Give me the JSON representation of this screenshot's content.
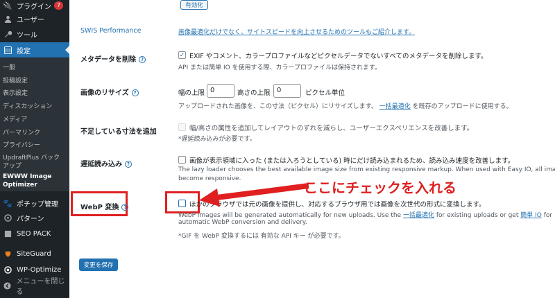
{
  "sidebar": {
    "plugins_label": "プラグイン",
    "plugins_badge": "7",
    "users_label": "ユーザー",
    "tools_label": "ツール",
    "settings_label": "設定",
    "submenu": [
      "一般",
      "投稿設定",
      "表示設定",
      "ディスカッション",
      "メディア",
      "パーマリンク",
      "プライバシー",
      "UpdraftPlus バック",
      "アップ",
      "EWWW Image",
      "Optimizer"
    ],
    "pochipp_label": "ポチップ管理",
    "patterns_label": "パターン",
    "seopack_label": "SEO PACK",
    "siteguard_label": "SiteGuard",
    "wpoptimize_label": "WP-Optimize",
    "close_menu_label": "メニューを閉じる"
  },
  "main": {
    "enable_button": "有効化",
    "swis_label": "SWIS Performance",
    "swis_link": "画像最適化だけでなく、サイトスピードを向上させるためのツールもご紹介します。",
    "metadata": {
      "label": "メタデータを削除",
      "option": "EXIF やコメント、カラープロファイルなどピクセルデータでないすべてのメタデータを削除します。",
      "desc": "API または簡単 IO を使用する際、カラープロファイルは保持されます。"
    },
    "resize": {
      "label": "画像のリサイズ",
      "width_label": "幅の上限",
      "width_value": "0",
      "height_label": "高さの上限",
      "height_value": "0",
      "unit_label": "ピクセル単位",
      "desc_prefix": "アップロードされた画像を、この寸法（ピクセル）にリサイズします。",
      "desc_link": "一括最適化",
      "desc_suffix": "を既存のアップロードに使用する。"
    },
    "dimensions": {
      "label": "不足している寸法を追加",
      "option": "幅/高さの属性を追加してレイアウトのずれを減らし、ユーザーエクスペリエンスを改善します。",
      "desc": "*遅延読み込みが必要です。"
    },
    "lazy": {
      "label": "遅延読み込み",
      "option": "画像が表示領域に入った (または入ろうとしている) 時にだけ読み込まれるため、読み込み速度を改善します。",
      "desc_line1": "The lazy loader chooses the best available image size from existing responsive markup. When used with Easy IO, all images",
      "desc_line2": "become responsive."
    },
    "webp": {
      "label": "WebP 変換",
      "option": "ほかのブラウザでは元の画像を提供し、対応するブラウザ用では画像を次世代の形式に変換します。",
      "desc_line1_prefix": "WebP images will be generated automatically for new uploads. Use the",
      "desc_line1_link1": "一括最適化",
      "desc_line1_mid": "for existing uploads or get",
      "desc_line1_link2": "簡単 IO",
      "desc_line1_suffix": "for",
      "desc_line2": "automatic WebP conversion and delivery.",
      "note": "*GIF を WebP 変換するには 有効な API キー が必要です。"
    },
    "save_button": "変更を保存",
    "annotation": "ここにチェックを入れる"
  },
  "colors": {
    "sidebar_bg": "#1d2327",
    "accent": "#2271b1",
    "annotation_red": "#e02020"
  }
}
